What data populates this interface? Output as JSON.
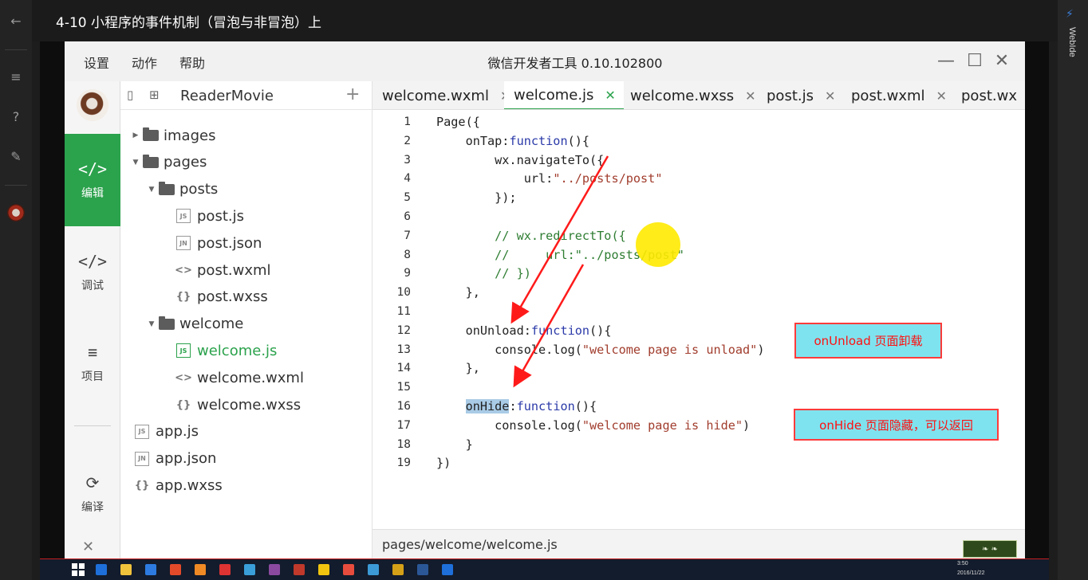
{
  "player": {
    "title": "4-10 小程序的事件机制（冒泡与非冒泡）上",
    "right_label": "WebIde"
  },
  "devtools": {
    "menu": [
      "设置",
      "动作",
      "帮助"
    ],
    "title": "微信开发者工具 0.10.102800",
    "sidebar": [
      {
        "label": "编辑",
        "icon": "code-square-icon",
        "active": true
      },
      {
        "label": "调试",
        "icon": "debug-code-icon",
        "active": false
      },
      {
        "label": "项目",
        "icon": "menu-lines-icon",
        "active": false
      },
      {
        "label": "编译",
        "icon": "compile-icon",
        "active": false
      }
    ],
    "project_name": "ReaderMovie",
    "tree": [
      {
        "label": "images",
        "type": "folder",
        "depth": 0,
        "expanded": false
      },
      {
        "label": "pages",
        "type": "folder",
        "depth": 0,
        "expanded": true
      },
      {
        "label": "posts",
        "type": "folder",
        "depth": 1,
        "expanded": true
      },
      {
        "label": "post.js",
        "type": "js",
        "depth": 2
      },
      {
        "label": "post.json",
        "type": "json",
        "depth": 2
      },
      {
        "label": "post.wxml",
        "type": "wxml",
        "depth": 2
      },
      {
        "label": "post.wxss",
        "type": "wxss",
        "depth": 2
      },
      {
        "label": "welcome",
        "type": "folder",
        "depth": 1,
        "expanded": true
      },
      {
        "label": "welcome.js",
        "type": "js",
        "depth": 2,
        "active": true
      },
      {
        "label": "welcome.wxml",
        "type": "wxml",
        "depth": 2
      },
      {
        "label": "welcome.wxss",
        "type": "wxss",
        "depth": 2
      },
      {
        "label": "app.js",
        "type": "js",
        "depth": 0
      },
      {
        "label": "app.json",
        "type": "json",
        "depth": 0
      },
      {
        "label": "app.wxss",
        "type": "wxss",
        "depth": 0
      }
    ],
    "file_icon_text": {
      "js": "JS",
      "json": "JN",
      "wxml": "<>",
      "wxss": "{}"
    },
    "tabs": [
      {
        "label": "welcome.wxml",
        "active": false
      },
      {
        "label": "welcome.js",
        "active": true
      },
      {
        "label": "welcome.wxss",
        "active": false
      },
      {
        "label": "post.js",
        "active": false
      },
      {
        "label": "post.wxml",
        "active": false
      },
      {
        "label": "post.wx",
        "active": false
      }
    ],
    "code_lines": [
      [
        [
          "",
          "Page({"
        ]
      ],
      [
        [
          "",
          "    onTap:"
        ],
        [
          "fn",
          "function"
        ],
        [
          "",
          "(){"
        ]
      ],
      [
        [
          "",
          "        wx.navigateTo({"
        ]
      ],
      [
        [
          "",
          "            url:"
        ],
        [
          "str",
          "\"../posts/post\""
        ]
      ],
      [
        [
          "",
          "        });"
        ]
      ],
      [
        [
          "",
          ""
        ]
      ],
      [
        [
          "cmt",
          "        // wx.redirectTo({"
        ]
      ],
      [
        [
          "cmt",
          "        //     url:\"../posts/post\""
        ]
      ],
      [
        [
          "cmt",
          "        // })"
        ]
      ],
      [
        [
          "",
          "    },"
        ]
      ],
      [
        [
          "",
          ""
        ]
      ],
      [
        [
          "",
          "    onUnload:"
        ],
        [
          "fn",
          "function"
        ],
        [
          "",
          "(){"
        ]
      ],
      [
        [
          "",
          "        console.log("
        ],
        [
          "str",
          "\"welcome page is unload\""
        ],
        [
          "",
          ")"
        ]
      ],
      [
        [
          "",
          "    },"
        ]
      ],
      [
        [
          "",
          ""
        ]
      ],
      [
        [
          "",
          "    "
        ],
        [
          "sel",
          "onHide"
        ],
        [
          "",
          ":"
        ],
        [
          "fn",
          "function"
        ],
        [
          "",
          "(){"
        ]
      ],
      [
        [
          "",
          "        console.log("
        ],
        [
          "str",
          "\"welcome page is hide\""
        ],
        [
          "",
          ")"
        ]
      ],
      [
        [
          "",
          "    }"
        ]
      ],
      [
        [
          "",
          "})"
        ]
      ]
    ],
    "status_path": "pages/welcome/welcome.js",
    "annotations": [
      {
        "text": "onUnload 页面卸载"
      },
      {
        "text": "onHide 页面隐藏，可以返回"
      }
    ],
    "annotation_colors": {
      "fill": "#7fe3ef",
      "border": "#ff3b3b",
      "text": "#ff1010",
      "arrow": "#ff1a1a"
    }
  },
  "taskbar": {
    "time": "3:50",
    "date": "2016/11/22",
    "icon_colors": [
      "#1e6fd9",
      "#f0c33c",
      "#2d7be0",
      "#e34a2a",
      "#f08a24",
      "#d33",
      "#3a9ed8",
      "#8b4aa0",
      "#c0392b",
      "#f1c40f",
      "#e84c3d",
      "#3c9ad6",
      "#d4a017",
      "#2b5797",
      "#1e6fd9"
    ]
  },
  "colors": {
    "accent": "#2ba24c",
    "keyword": "#2b3aa8",
    "string": "#a13d2d",
    "comment": "#2e7d32",
    "selection": "#a9cbe6"
  }
}
